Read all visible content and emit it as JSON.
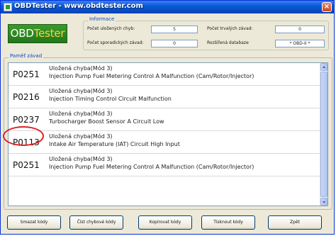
{
  "window": {
    "title": "OBDTester - www.obdtester.com",
    "close_label": "×"
  },
  "logo": {
    "part1": "OBD",
    "part2": "Tester"
  },
  "info": {
    "group_label": "Informace",
    "stored_label": "Počet uložených chyb:",
    "stored_value": "5",
    "permanent_label": "Počet trvalých závad:",
    "permanent_value": "0",
    "sporadic_label": "Počet sporadických závad:",
    "sporadic_value": "0",
    "extended_label": "Rozšířená databaze",
    "extended_value": "* OBD-II *"
  },
  "memory": {
    "group_label": "Paměť závad",
    "faults": [
      {
        "code": "P0251",
        "status": "Uložená chyba(Mód 3)",
        "description": "Injection Pump Fuel Metering Control A Malfunction (Cam/Rotor/Injector)"
      },
      {
        "code": "P0216",
        "status": "Uložená chyba(Mód 3)",
        "description": "Injection Timing Control Circuit Malfunction"
      },
      {
        "code": "P0237",
        "status": "Uložená chyba(Mód 3)",
        "description": "Turbocharger Boost Sensor A Circuit Low"
      },
      {
        "code": "P0113",
        "status": "Uložená chyba(Mód 3)",
        "description": "Intake Air Temperature (IAT) Circuit High Input"
      },
      {
        "code": "P0251",
        "status": "Uložená chyba(Mód 3)",
        "description": "Injection Pump Fuel Metering Control A Malfunction (Cam/Rotor/Injector)"
      }
    ]
  },
  "buttons": {
    "clear": "Smazat kódy",
    "read": "Číst chybové kódy",
    "copy": "Kopírovat kódy",
    "print": "Tisknout kódy",
    "back": "Zpět"
  },
  "colors": {
    "title_bar": "#0a5ad6",
    "window_bg": "#ece9d8",
    "group_label": "#1046c8",
    "logo_bg": "#2f8a22",
    "highlight": "#e02020"
  }
}
